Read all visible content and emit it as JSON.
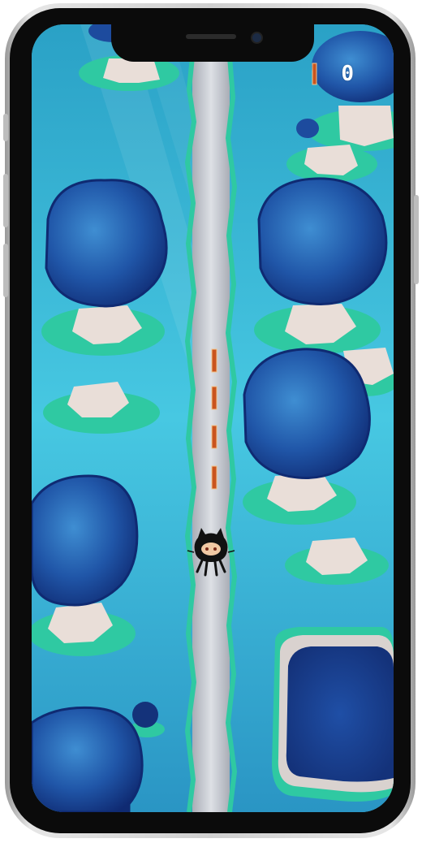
{
  "hud": {
    "score": "0",
    "pause_icon": "pause-icon"
  },
  "player": {
    "character": "octocat",
    "icon": "octocat-icon"
  },
  "scene": {
    "lane_markers": 4,
    "colors": {
      "water": "#3fb7d3",
      "road": "#c8cbd1",
      "grass": "#2fc9a2",
      "tree_dark": "#10307f",
      "tree_light": "#3a82c8",
      "stump": "#e9ded8",
      "marker": "#c9541e"
    }
  }
}
